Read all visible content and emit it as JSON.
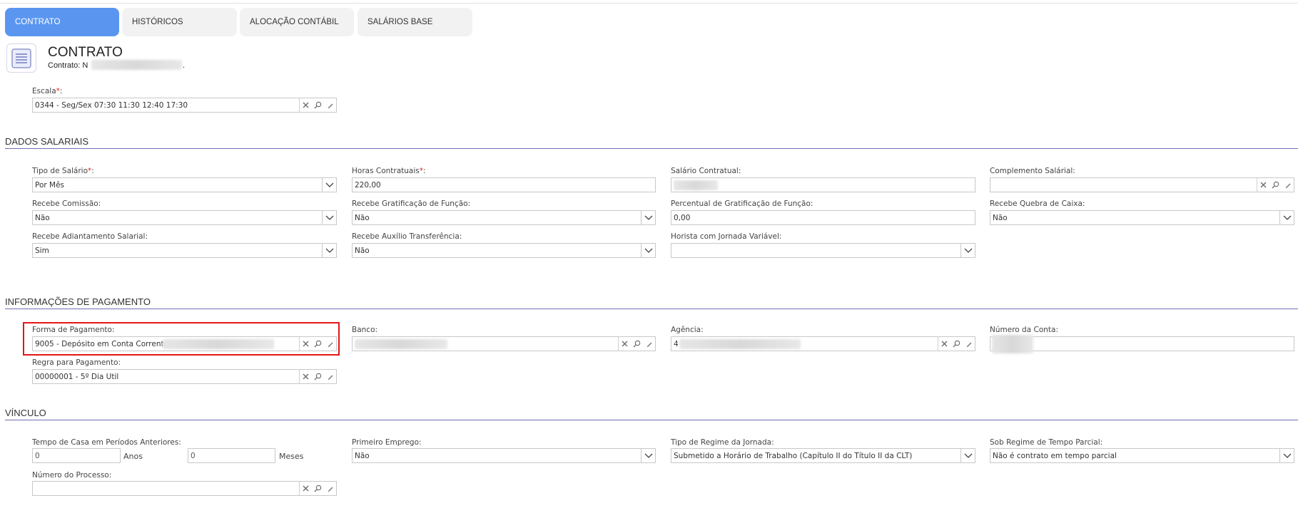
{
  "tabs": [
    {
      "label": "CONTRATO",
      "active": true
    },
    {
      "label": "HISTÓRICOS",
      "active": false
    },
    {
      "label": "ALOCAÇÃO CONTÁBIL",
      "active": false
    },
    {
      "label": "SALÁRIOS BASE",
      "active": false
    }
  ],
  "header": {
    "title": "CONTRATO",
    "subtitle_prefix": "Contrato: ",
    "subtitle_visible": "N",
    "subtitle_suffix": "."
  },
  "escala": {
    "label": "Escala",
    "required": "*",
    "colon": ":",
    "value": "0344 - Seg/Sex 07:30 11:30 12:40 17:30"
  },
  "sections": {
    "dados_salariais": "DADOS SALARIAIS",
    "pagamento": "INFORMAÇÕES DE PAGAMENTO",
    "vinculo": "VÍNCULO"
  },
  "salarios": {
    "tipo": {
      "label": "Tipo de Salário",
      "value": "Por Mês"
    },
    "horas": {
      "label": "Horas Contratuais",
      "value": "220,00"
    },
    "salario_contratual": {
      "label": "Salário Contratual:",
      "value": ""
    },
    "complemento": {
      "label": "Complemento Salárial:",
      "value": ""
    },
    "comissao": {
      "label": "Recebe Comissão:",
      "value": "Não"
    },
    "gratificacao": {
      "label": "Recebe Gratificação de Função:",
      "value": "Não"
    },
    "percentual": {
      "label": "Percentual de Gratificação de Função:",
      "value": "0,00"
    },
    "quebra": {
      "label": "Recebe Quebra de Caixa:",
      "value": "Não"
    },
    "adiantamento": {
      "label": "Recebe Adiantamento Salarial:",
      "value": "Sim"
    },
    "auxilio": {
      "label": "Recebe Auxílio Transferência:",
      "value": "Não"
    },
    "horista": {
      "label": "Horista com Jornada Variável:",
      "value": ""
    }
  },
  "pagamento": {
    "forma": {
      "label": "Forma de Pagamento:",
      "value": "9005 - Depósito em Conta Corrente"
    },
    "banco": {
      "label": "Banco:",
      "value": ""
    },
    "agencia": {
      "label": "Agência:",
      "value": "4"
    },
    "conta": {
      "label": "Número da Conta:",
      "value": ""
    },
    "regra": {
      "label": "Regra para Pagamento:",
      "value": "00000001 - 5º Dia Útil"
    }
  },
  "vinculo": {
    "tempo": {
      "label": "Tempo de Casa em Períodos Anteriores:",
      "anos_value": "0",
      "anos_unit": "Anos",
      "meses_value": "0",
      "meses_unit": "Meses"
    },
    "primeiro": {
      "label": "Primeiro Emprego:",
      "value": "Não"
    },
    "regime": {
      "label": "Tipo de Regime da Jornada:",
      "value": "Submetido a Horário de Trabalho (Capítulo II do Título II da CLT)"
    },
    "parcial": {
      "label": "Sob Regime de Tempo Parcial:",
      "value": "Não é contrato em tempo parcial"
    },
    "processo": {
      "label": "Número do Processo:",
      "value": ""
    }
  },
  "colors": {
    "tab_active": "#5a96f0",
    "section_line": "#6f6fb5",
    "required": "#e0261e",
    "highlight": "#e3151a"
  },
  "icons": [
    "document-icon",
    "clear-icon",
    "search-icon",
    "edit-icon",
    "chevron-down-icon"
  ]
}
